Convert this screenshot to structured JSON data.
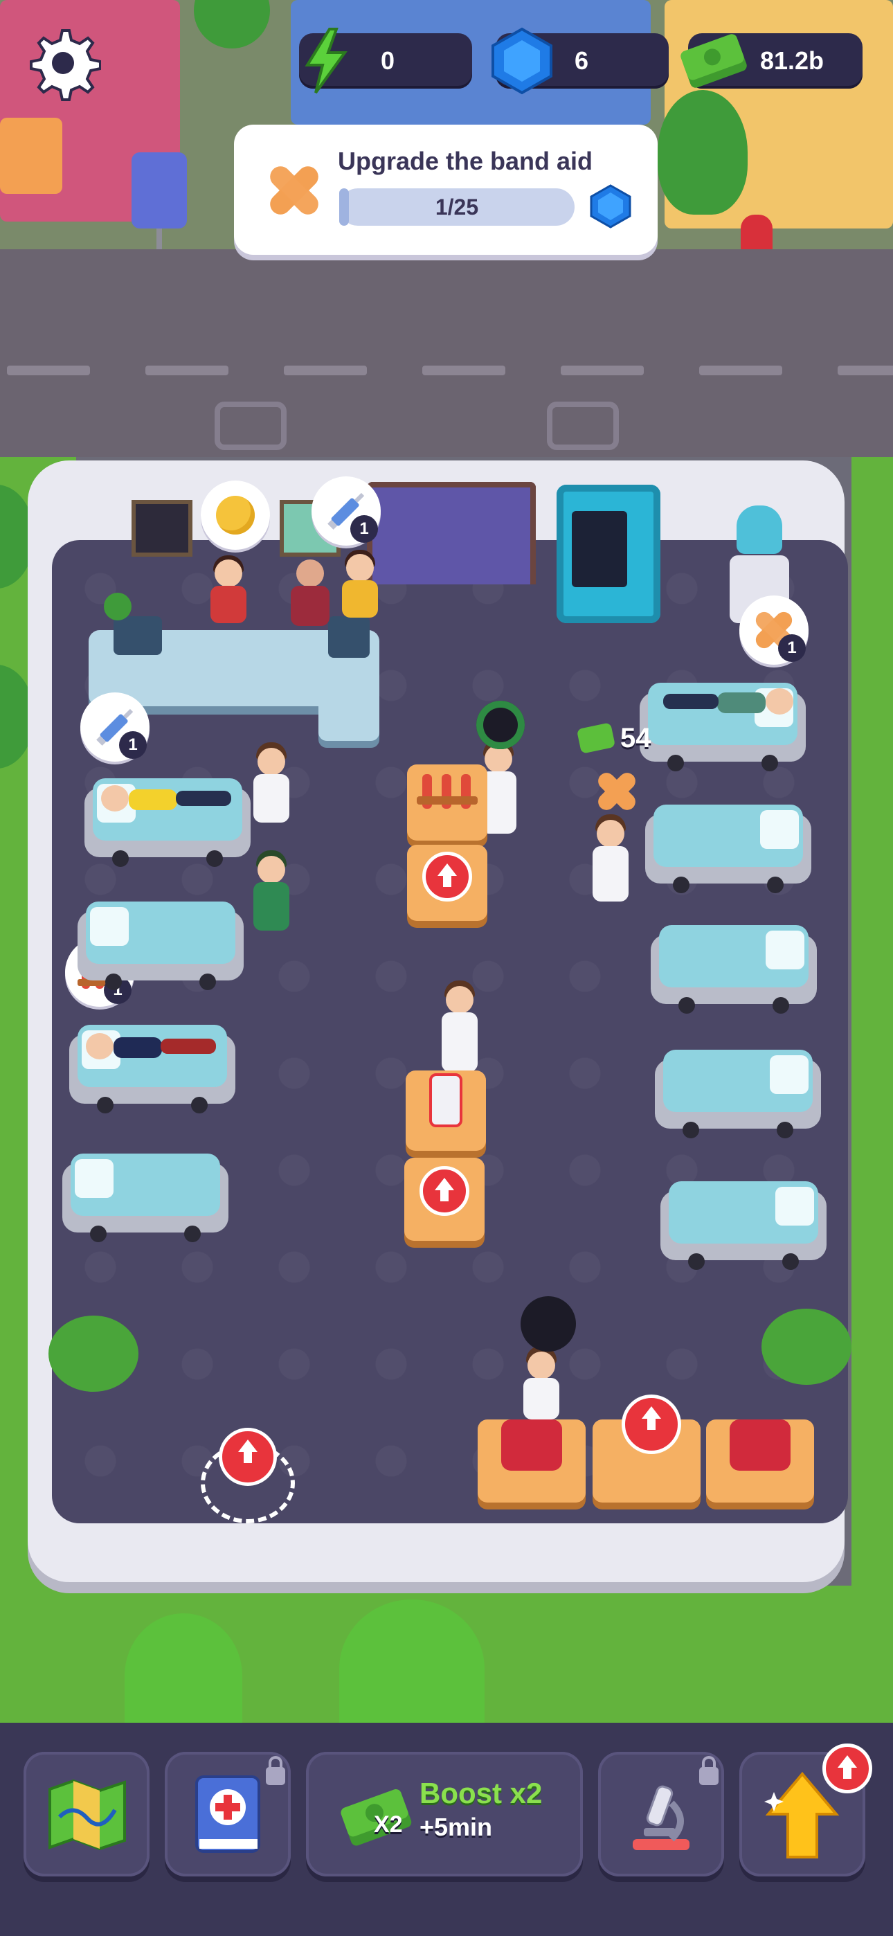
{
  "hud": {
    "energy": "0",
    "gems": "6",
    "cash": "81.2b",
    "icons": {
      "settings": "gear-icon",
      "energy": "lightning-icon",
      "gems": "gem-icon",
      "cash": "cash-stack-icon"
    }
  },
  "task": {
    "title": "Upgrade the band aid",
    "progress_text": "1/25",
    "progress": {
      "current": 1,
      "total": 25
    },
    "icon": "band-aid-icon",
    "reward_icon": "gem-icon"
  },
  "floor": {
    "cash_popup": "54",
    "bubbles": [
      {
        "icon": "sick-face-icon",
        "count": ""
      },
      {
        "icon": "syringe-icon",
        "count": "1"
      },
      {
        "icon": "syringe-icon",
        "count": "1"
      },
      {
        "icon": "test-tubes-icon",
        "count": "1"
      },
      {
        "icon": "band-aid-icon",
        "count": "1"
      }
    ]
  },
  "bottom_bar": {
    "map_icon": "map-icon",
    "book_icon": "medical-book-icon",
    "boost_title": "Boost x2",
    "boost_multiplier": "X2",
    "boost_time": "+5min",
    "lab_icon": "microscope-icon",
    "upgrade_icon": "upgrade-arrow-icon"
  },
  "colors": {
    "hud_bg": "#2d2a4b",
    "floor": "#4b4766",
    "boost_text": "#8be04e",
    "upgrade_red": "#e8343c",
    "table": "#f5b063",
    "bed_mattress": "#8fd3e0"
  }
}
